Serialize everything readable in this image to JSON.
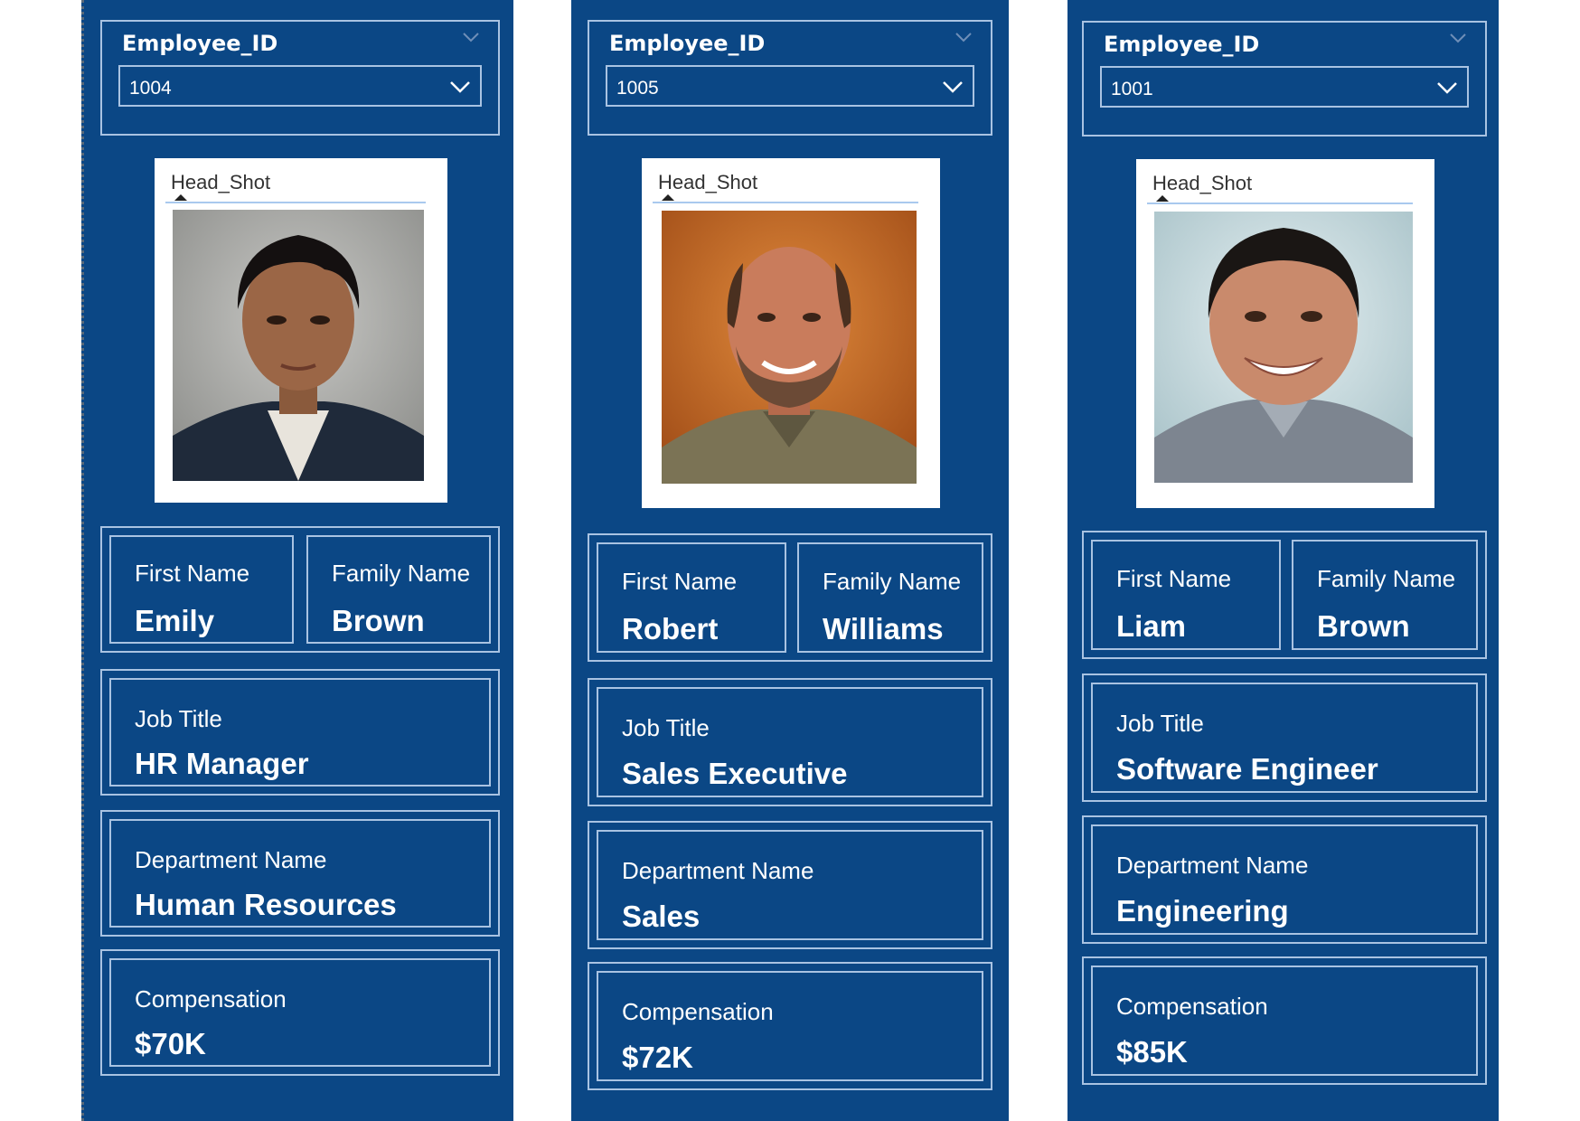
{
  "panels": [
    {
      "slicer": {
        "label": "Employee_ID",
        "selected": "1004"
      },
      "photo": {
        "title": "Head_Shot",
        "icon": "portrait-woman-icon"
      },
      "first_name": {
        "label": "First Name",
        "value": "Emily"
      },
      "family_name": {
        "label": "Family Name",
        "value": "Brown"
      },
      "job_title": {
        "label": "Job Title",
        "value": "HR Manager"
      },
      "department": {
        "label": "Department Name",
        "value": "Human Resources"
      },
      "compensation": {
        "label": "Compensation",
        "value": "$70K"
      }
    },
    {
      "slicer": {
        "label": "Employee_ID",
        "selected": "1005"
      },
      "photo": {
        "title": "Head_Shot",
        "icon": "portrait-man-bald-icon"
      },
      "first_name": {
        "label": "First Name",
        "value": "Robert"
      },
      "family_name": {
        "label": "Family Name",
        "value": "Williams"
      },
      "job_title": {
        "label": "Job Title",
        "value": "Sales Executive"
      },
      "department": {
        "label": "Department Name",
        "value": "Sales"
      },
      "compensation": {
        "label": "Compensation",
        "value": "$72K"
      }
    },
    {
      "slicer": {
        "label": "Employee_ID",
        "selected": "1001"
      },
      "photo": {
        "title": "Head_Shot",
        "icon": "portrait-man-smiling-icon"
      },
      "first_name": {
        "label": "First Name",
        "value": "Liam"
      },
      "family_name": {
        "label": "Family Name",
        "value": "Brown"
      },
      "job_title": {
        "label": "Job Title",
        "value": "Software Engineer"
      },
      "department": {
        "label": "Department Name",
        "value": "Engineering"
      },
      "compensation": {
        "label": "Compensation",
        "value": "$85K"
      }
    }
  ],
  "colors": {
    "panel_bg": "#0b4785",
    "border": "#a9c3e2",
    "text": "#ffffff"
  }
}
